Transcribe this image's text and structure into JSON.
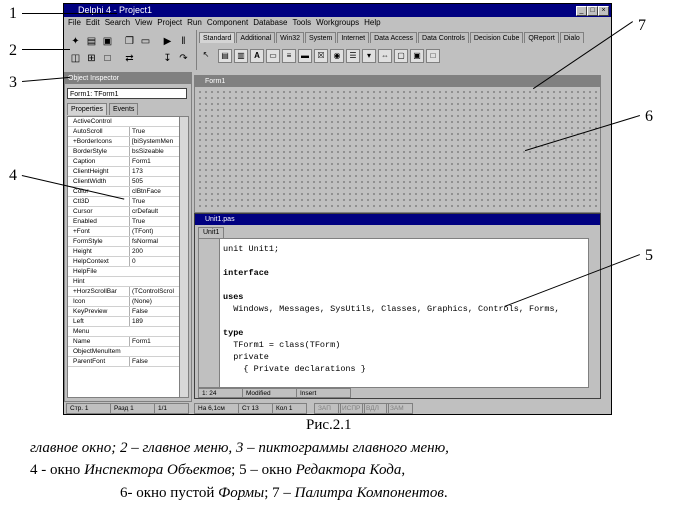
{
  "callouts": [
    "1",
    "2",
    "3",
    "4",
    "5",
    "6",
    "7"
  ],
  "window": {
    "title": "Delphi 4 - Project1",
    "buttons": [
      "_",
      "□",
      "×"
    ]
  },
  "menu": [
    "File",
    "Edit",
    "Search",
    "View",
    "Project",
    "Run",
    "Component",
    "Database",
    "Tools",
    "Workgroups",
    "Help"
  ],
  "palette_tabs": [
    "Standard",
    "Additional",
    "Win32",
    "System",
    "Internet",
    "Data Access",
    "Data Controls",
    "Decision Cube",
    "QReport",
    "Dialo"
  ],
  "inspector": {
    "title": "Object Inspector",
    "selected": "Form1: TForm1",
    "tabs": [
      "Properties",
      "Events"
    ],
    "props": [
      [
        "ActiveControl",
        ""
      ],
      [
        "AutoScroll",
        "True"
      ],
      [
        "+BorderIcons",
        "[biSystemMen"
      ],
      [
        "BorderStyle",
        "bsSizeable"
      ],
      [
        "Caption",
        "Form1"
      ],
      [
        "ClientHeight",
        "173"
      ],
      [
        "ClientWidth",
        "505"
      ],
      [
        "Color",
        "clBtnFace"
      ],
      [
        "Ctl3D",
        "True"
      ],
      [
        "Cursor",
        "crDefault"
      ],
      [
        "Enabled",
        "True"
      ],
      [
        "+Font",
        "(TFont)"
      ],
      [
        "FormStyle",
        "fsNormal"
      ],
      [
        "Height",
        "200"
      ],
      [
        "HelpContext",
        "0"
      ],
      [
        "HelpFile",
        ""
      ],
      [
        "Hint",
        ""
      ],
      [
        "+HorzScrollBar",
        "(TControlScrol"
      ],
      [
        "Icon",
        "(None)"
      ],
      [
        "KeyPreview",
        "False"
      ],
      [
        "Left",
        "189"
      ],
      [
        "Menu",
        ""
      ],
      [
        "Name",
        "Form1"
      ],
      [
        "ObjectMenuItem",
        ""
      ],
      [
        "ParentFont",
        "False"
      ]
    ]
  },
  "form": {
    "title": "Form1"
  },
  "editor": {
    "title": "Unit1.pas",
    "tab": "Unit1",
    "code": [
      "unit Unit1;",
      "",
      "interface",
      "",
      "uses",
      "  Windows, Messages, SysUtils, Classes, Graphics, Controls, Forms,",
      "",
      "type",
      "  TForm1 = class(TForm)",
      "  private",
      "    { Private declarations }"
    ],
    "status": {
      "pos": "1: 24",
      "modified": "Modified",
      "mode": "Insert"
    }
  },
  "bottom_status": [
    "Стр. 1",
    "Разд 1",
    "1/1",
    "На 6,1см",
    "Ст 13",
    "Кол 1",
    "ЗАП",
    "ИСПР",
    "ВДЛ",
    "ЗАМ"
  ],
  "caption": {
    "title": "Рис.2.1",
    "line1": "главное окно; 2 – главное меню, 3 – пиктограммы главного меню,",
    "line2_pre": "4 - окно ",
    "line2_it1": "Инспектора Объектов",
    "line2_mid": "; 5 – окно ",
    "line2_it2": "Редактора Кода",
    "line2_end": ",",
    "line3_pre": "6- окно пустой ",
    "line3_it1": "Формы",
    "line3_mid": "; 7 – ",
    "line3_it2": "Палитра Компонентов",
    "line3_end": "."
  }
}
